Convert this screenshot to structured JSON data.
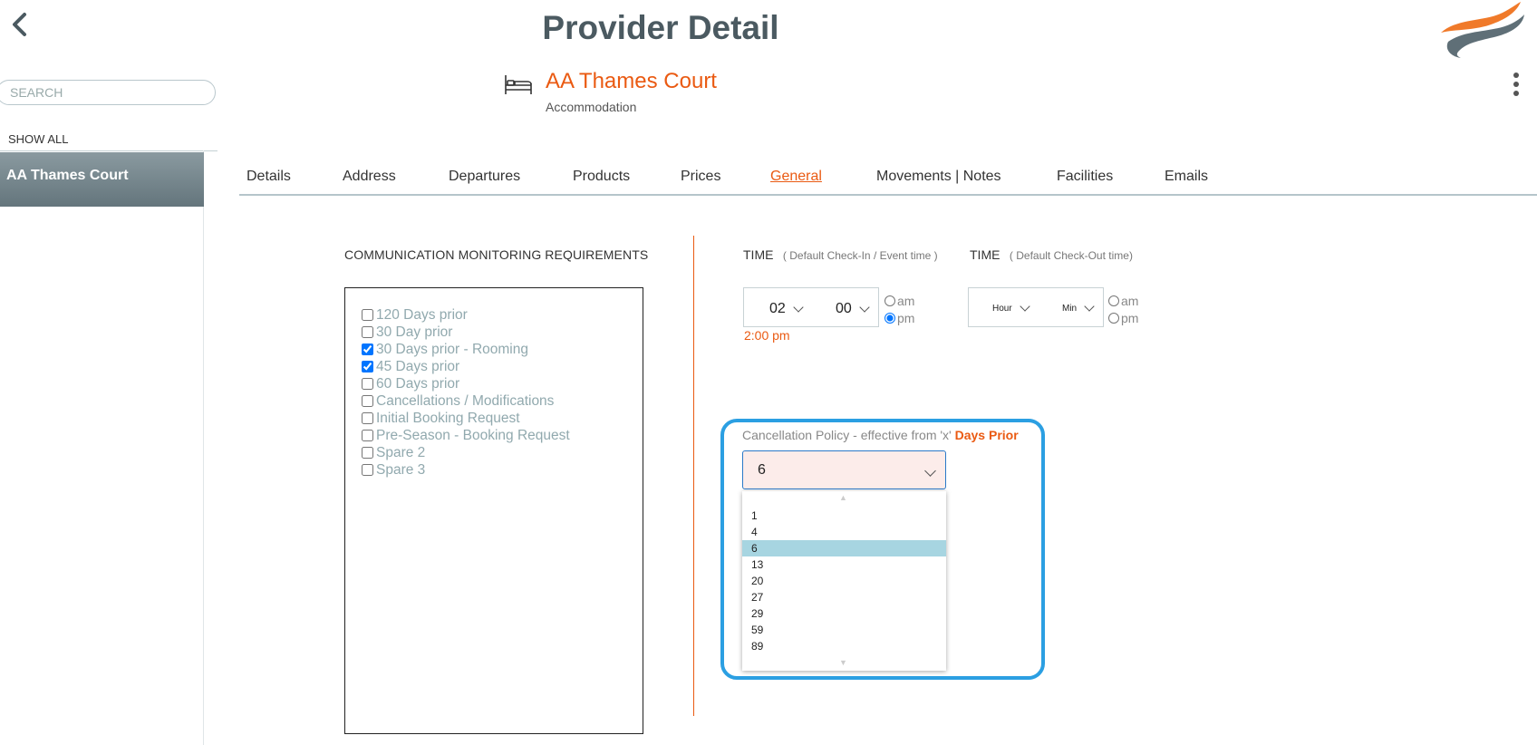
{
  "header": {
    "title": "Provider Detail"
  },
  "sidebar": {
    "search_placeholder": "SEARCH",
    "show_all": "SHOW ALL",
    "items": [
      {
        "label": "AA Thames Court"
      }
    ]
  },
  "provider": {
    "name": "AA Thames Court",
    "type": "Accommodation"
  },
  "tabs": [
    {
      "label": "Details"
    },
    {
      "label": "Address"
    },
    {
      "label": "Departures"
    },
    {
      "label": "Products"
    },
    {
      "label": "Prices"
    },
    {
      "label": "General",
      "active": true
    },
    {
      "label": "Movements | Notes"
    },
    {
      "label": "Facilities"
    },
    {
      "label": "Emails"
    }
  ],
  "communication": {
    "title": "COMMUNICATION MONITORING REQUIREMENTS",
    "items": [
      {
        "label": "120 Days prior",
        "checked": false
      },
      {
        "label": "30 Day prior",
        "checked": false
      },
      {
        "label": "30 Days prior - Rooming",
        "checked": true
      },
      {
        "label": "45 Days prior",
        "checked": true
      },
      {
        "label": "60 Days prior",
        "checked": false
      },
      {
        "label": "Cancellations / Modifications",
        "checked": false
      },
      {
        "label": "Initial Booking Request",
        "checked": false
      },
      {
        "label": "Pre-Season - Booking Request",
        "checked": false
      },
      {
        "label": "Spare 2",
        "checked": false
      },
      {
        "label": "Spare 3",
        "checked": false
      }
    ]
  },
  "checkin_time": {
    "label": "TIME",
    "sublabel": "( Default Check-In / Event time )",
    "hour": "02",
    "minute": "00",
    "am_label": "am",
    "pm_label": "pm",
    "selected_period": "pm",
    "readout": "2:00 pm"
  },
  "checkout_time": {
    "label": "TIME",
    "sublabel": "( Default Check-Out time)",
    "hour": "Hour",
    "minute": "Min",
    "am_label": "am",
    "pm_label": "pm",
    "selected_period": null
  },
  "cancellation": {
    "label": "Cancellation Policy - effective from 'x'",
    "label_emphasis": "Days Prior",
    "selected": "6",
    "options": [
      "1",
      "4",
      "6",
      "13",
      "20",
      "27",
      "29",
      "59",
      "89"
    ]
  },
  "colors": {
    "accent": "#ea5a12",
    "highlight_border": "#2b9fe2",
    "title": "#4b5a61"
  },
  "icons": [
    "back-arrow-icon",
    "logo-swoosh-icon",
    "kebab-menu-icon",
    "bed-icon",
    "chevron-down-icon"
  ]
}
